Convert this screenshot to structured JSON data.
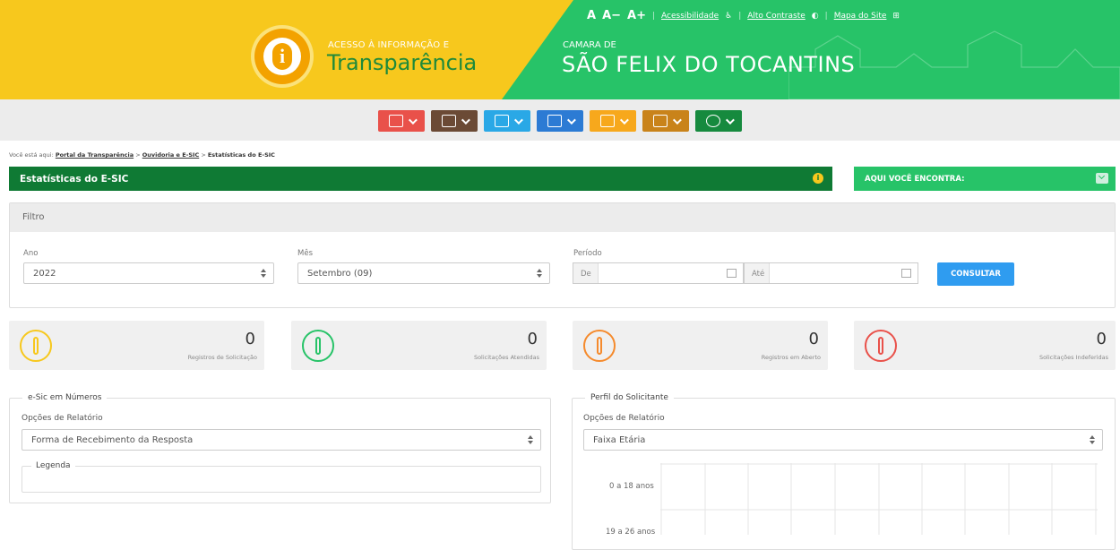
{
  "header": {
    "brand_tag": "ACESSO À INFORMAÇÃO E",
    "brand_title": "Transparência",
    "org_tag": "CAMARA DE",
    "org_title": "SÃO FELIX DO TOCANTINS",
    "font_a": "A",
    "font_a_minus": "A−",
    "font_a_plus": "A+",
    "accessibility": "Acessibilidade",
    "high_contrast": "Alto Contraste",
    "sitemap": "Mapa do Site",
    "colors": {
      "yellow": "#f7c81d",
      "green": "#27c368",
      "dark_green": "#0f7a34"
    }
  },
  "toolbar": {
    "items": [
      {
        "icon": "edit-icon",
        "color": "#e9514a"
      },
      {
        "icon": "handshake-icon",
        "color": "#6b4a35"
      },
      {
        "icon": "people-icon",
        "color": "#2aa8e6"
      },
      {
        "icon": "chart-search-icon",
        "color": "#2c7bd4"
      },
      {
        "icon": "document-icon",
        "color": "#f7a81c"
      },
      {
        "icon": "scale-icon",
        "color": "#c9831a"
      },
      {
        "icon": "info-icon",
        "color": "#168a3e"
      }
    ]
  },
  "breadcrumb": {
    "prefix": "Você está aqui:",
    "home": "Portal da Transparência",
    "sep": ">",
    "section": "Ouvidoria e E-SIC",
    "current": "Estatísticas do E-SIC"
  },
  "page": {
    "title": "Estatísticas do E-SIC",
    "find_label": "AQUI VOCÊ ENCONTRA:"
  },
  "filter": {
    "title": "Filtro",
    "year_label": "Ano",
    "year_value": "2022",
    "month_label": "Mês",
    "month_value": "Setembro (09)",
    "period_label": "Período",
    "from_label": "De",
    "to_label": "Até",
    "submit": "CONSULTAR"
  },
  "stats": [
    {
      "value": "0",
      "caption": "Registros de Solicitação",
      "icon": "info-icon",
      "color": "#f7c81d"
    },
    {
      "value": "0",
      "caption": "Solicitações Atendidas",
      "icon": "info-check-icon",
      "color": "#27c368"
    },
    {
      "value": "0",
      "caption": "Registros em Aberto",
      "icon": "info-gear-icon",
      "color": "#f58a2c"
    },
    {
      "value": "0",
      "caption": "Solicitações Indeferidas",
      "icon": "info-x-icon",
      "color": "#e9514a"
    }
  ],
  "esic": {
    "legend": "e-Sic em Números",
    "options_label": "Opções de Relatório",
    "option_value": "Forma de Recebimento da Resposta",
    "subtitle": "Legenda"
  },
  "profile": {
    "legend": "Perfil do Solicitante",
    "options_label": "Opções de Relatório",
    "option_value": "Faixa Etária",
    "y_labels": [
      "0 a 18 anos",
      "19 a 26 anos"
    ]
  }
}
